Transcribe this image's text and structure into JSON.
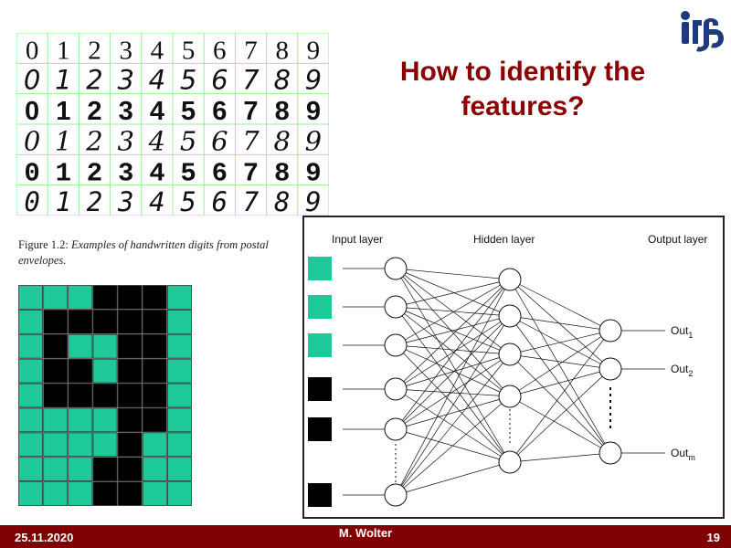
{
  "slide": {
    "title": "How to identify the features?",
    "caption_fig": "Figure 1.2:",
    "caption_text": "Examples of handwritten digits from postal envelopes."
  },
  "digits_image": {
    "digits": [
      "0",
      "1",
      "2",
      "3",
      "4",
      "5",
      "6",
      "7",
      "8",
      "9"
    ],
    "rows": 6
  },
  "pixel_grid": {
    "rows": 9,
    "cols": 7,
    "pattern": [
      "0001110",
      "0111110",
      "0100110",
      "0110110",
      "0111110",
      "0000110",
      "0000100",
      "0001100",
      "0001100"
    ],
    "colors": {
      "on": "#000000",
      "off": "#1ec99a"
    }
  },
  "network": {
    "input_label": "Input layer",
    "hidden_label": "Hidden layer",
    "output_label": "Output layer",
    "inputs": [
      "#1ec99a",
      "#1ec99a",
      "#1ec99a",
      "#000000",
      "#000000",
      "#000000"
    ],
    "outputs": [
      "Out",
      "Out",
      "Out"
    ],
    "output_subs": [
      "1",
      "2",
      "m"
    ]
  },
  "footer": {
    "date": "25.11.2020",
    "author": "M. Wolter",
    "page": "19"
  },
  "colors": {
    "title": "#8b0000",
    "footer": "#7f0000",
    "accent": "#1ec99a"
  }
}
